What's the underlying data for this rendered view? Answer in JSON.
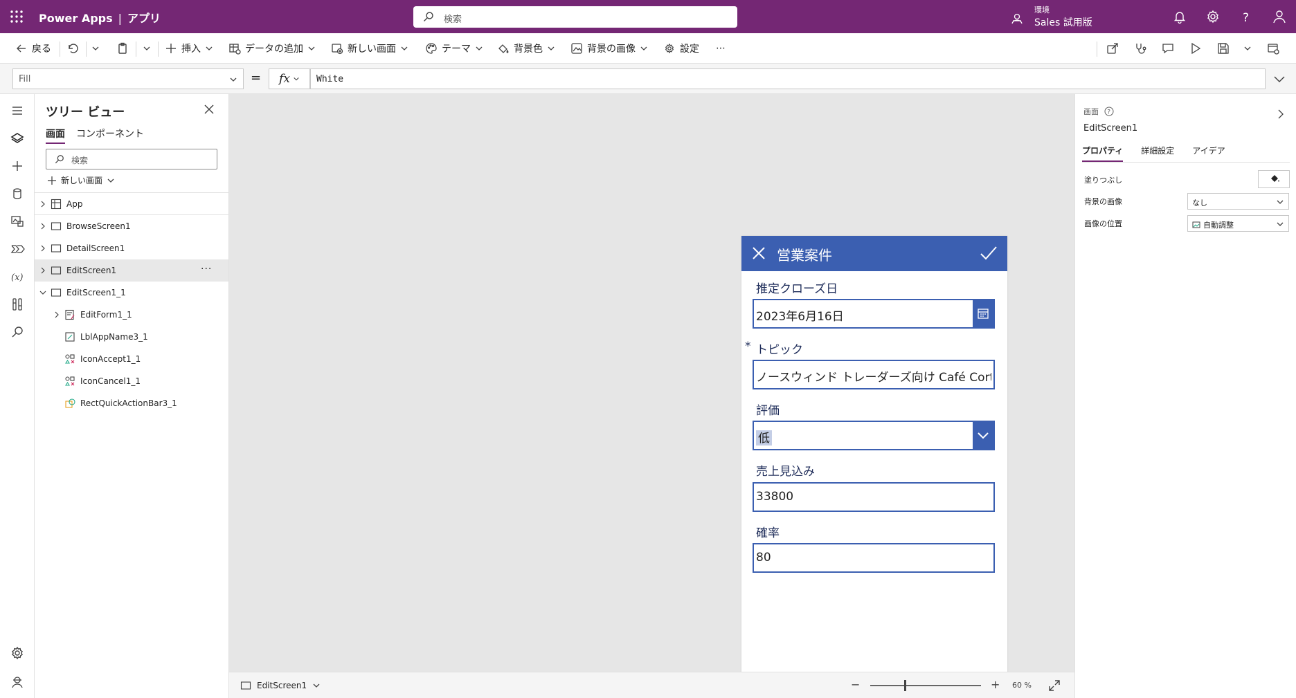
{
  "app": {
    "brand": "Power Apps",
    "separator": "|",
    "app_label": "アプリ",
    "search_placeholder": "検索",
    "environment_label": "環境",
    "environment_value": "Sales 試用版"
  },
  "toolbar": {
    "back": "戻る",
    "insert": "挿入",
    "add_data": "データの追加",
    "new_screen": "新しい画面",
    "theme": "テーマ",
    "background_color": "背景色",
    "background_image": "背景の画像",
    "settings": "設定",
    "more": "⋯"
  },
  "formula_bar": {
    "property": "Fill",
    "equals": "=",
    "fx": "fx",
    "formula": "White"
  },
  "tree": {
    "title": "ツリー ビュー",
    "tabs": [
      "画面",
      "コンポーネント"
    ],
    "search_placeholder": "検索",
    "new_screen": "新しい画面",
    "nodes": [
      {
        "label": "App"
      },
      {
        "label": "BrowseScreen1"
      },
      {
        "label": "DetailScreen1"
      },
      {
        "label": "EditScreen1"
      },
      {
        "label": "EditScreen1_1"
      },
      {
        "label": "EditForm1_1"
      },
      {
        "label": "LblAppName3_1"
      },
      {
        "label": "IconAccept1_1"
      },
      {
        "label": "IconCancel1_1"
      },
      {
        "label": "RectQuickActionBar3_1"
      }
    ],
    "more": "···"
  },
  "form": {
    "title": "営業案件",
    "fields": [
      {
        "label": "推定クローズ日",
        "value": "2023年6月16日"
      },
      {
        "label": "トピック",
        "required_marker": "*",
        "value": "ノースウィンド トレーダーズ向け Café Corto"
      },
      {
        "label": "評価",
        "value": "低"
      },
      {
        "label": "売上見込み",
        "value": "33800"
      },
      {
        "label": "確率",
        "value": "80"
      }
    ]
  },
  "canvas_footer": {
    "screen_name": "EditScreen1",
    "zoom_minus": "−",
    "zoom_plus": "+",
    "zoom_value": "60 %"
  },
  "properties": {
    "type_label": "画面",
    "name": "EditScreen1",
    "tabs": [
      "プロパティ",
      "詳細設定",
      "アイデア"
    ],
    "fill_label": "塗りつぶし",
    "bg_image_label": "背景の画像",
    "bg_image_value": "なし",
    "image_position_label": "画像の位置",
    "image_position_value": "自動調整"
  },
  "colors": {
    "brand": "#742774",
    "form_header": "#3b5fb1",
    "canvas": "#e6e6e6"
  }
}
